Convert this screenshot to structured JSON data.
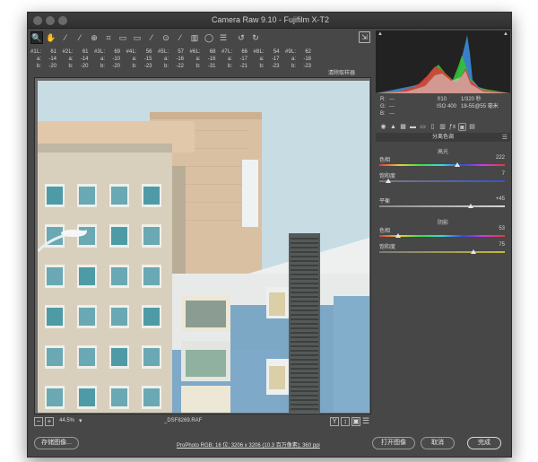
{
  "window": {
    "title": "Camera Raw 9.10  -  Fujifilm X-T2"
  },
  "toolbar": {
    "tools": [
      {
        "icon": "zoom-icon",
        "glyph": "🔍",
        "active": true
      },
      {
        "icon": "hand-icon",
        "glyph": "✋",
        "active": false
      },
      {
        "icon": "white-balance-icon",
        "glyph": "⁄",
        "active": false
      },
      {
        "icon": "color-sampler-icon",
        "glyph": "⁄",
        "active": false
      },
      {
        "icon": "targeted-adjustment-icon",
        "glyph": "⊕",
        "active": false
      },
      {
        "icon": "crop-icon",
        "glyph": "⌗",
        "active": false
      },
      {
        "icon": "straighten-icon",
        "glyph": "▭",
        "active": false
      },
      {
        "icon": "transform-icon",
        "glyph": "▭",
        "active": false
      },
      {
        "icon": "spot-removal-icon",
        "glyph": "⁄",
        "active": false
      },
      {
        "icon": "red-eye-icon",
        "glyph": "⊙",
        "active": false
      },
      {
        "icon": "adjustment-brush-icon",
        "glyph": "⁄",
        "active": false
      },
      {
        "icon": "graduated-filter-icon",
        "glyph": "▥",
        "active": false
      },
      {
        "icon": "radial-filter-icon",
        "glyph": "◯",
        "active": false
      },
      {
        "icon": "preferences-icon",
        "glyph": "☰",
        "active": false
      },
      {
        "icon": "rotate-left-icon",
        "glyph": "↺",
        "active": false
      },
      {
        "icon": "rotate-right-icon",
        "glyph": "↻",
        "active": false
      }
    ],
    "export_icon": "export-icon",
    "export_glyph": "⇲"
  },
  "samplers": [
    {
      "label": "#1",
      "rows": [
        [
          "L:",
          "61"
        ],
        [
          "a:",
          "-14"
        ],
        [
          "b:",
          "-20"
        ]
      ]
    },
    {
      "label": "#2",
      "rows": [
        [
          "L:",
          "61"
        ],
        [
          "a:",
          "-14"
        ],
        [
          "b:",
          "-20"
        ]
      ]
    },
    {
      "label": "#3",
      "rows": [
        [
          "L:",
          "69"
        ],
        [
          "a:",
          "-10"
        ],
        [
          "b:",
          "-20"
        ]
      ]
    },
    {
      "label": "#4",
      "rows": [
        [
          "L:",
          "56"
        ],
        [
          "a:",
          "-15"
        ],
        [
          "b:",
          "-23"
        ]
      ]
    },
    {
      "label": "#5",
      "rows": [
        [
          "L:",
          "57"
        ],
        [
          "a:",
          "-16"
        ],
        [
          "b:",
          "-22"
        ]
      ]
    },
    {
      "label": "#6",
      "rows": [
        [
          "L:",
          "68"
        ],
        [
          "a:",
          "-16"
        ],
        [
          "b:",
          "-31"
        ]
      ]
    },
    {
      "label": "#7",
      "rows": [
        [
          "L:",
          "66"
        ],
        [
          "a:",
          "-17"
        ],
        [
          "b:",
          "-21"
        ]
      ]
    },
    {
      "label": "#8",
      "rows": [
        [
          "L:",
          "54"
        ],
        [
          "a:",
          "-17"
        ],
        [
          "b:",
          "-23"
        ]
      ]
    },
    {
      "label": "#9",
      "rows": [
        [
          "L:",
          "62"
        ],
        [
          "a:",
          "-18"
        ],
        [
          "b:",
          "-23"
        ]
      ]
    }
  ],
  "clear_samplers_label": "清除取样器",
  "status": {
    "zoom": "44.5%",
    "filename": "_DSF8269.RAF"
  },
  "histogram": {
    "rgb_labels": [
      "R:",
      "G:",
      "B:"
    ],
    "rgb_values": [
      "---",
      "---",
      "---"
    ],
    "exif": {
      "aperture": "f/10",
      "shutter": "1/320 秒",
      "iso": "ISO 400",
      "lens": "18-55@55 毫米"
    }
  },
  "panel_tabs": [
    "◉",
    "▲",
    "▦",
    "▬",
    "▭",
    "▯",
    "▥",
    "ƒx",
    "◙",
    "▤"
  ],
  "split_toning": {
    "title": "分离色调",
    "highlights": {
      "title": "高光",
      "hue": {
        "name": "色相",
        "value": "222",
        "fraction": 0.62
      },
      "saturation": {
        "name": "饱和度",
        "value": "7",
        "fraction": 0.07
      }
    },
    "balance": {
      "name": "平衡",
      "value": "+45",
      "fraction": 0.725
    },
    "shadows": {
      "title": "阴影",
      "hue": {
        "name": "色相",
        "value": "53",
        "fraction": 0.15
      },
      "saturation": {
        "name": "饱和度",
        "value": "75",
        "fraction": 0.75
      }
    }
  },
  "bottom": {
    "save_label": "存储图像...",
    "workflow_label": "ProPhoto RGB; 16 位; 3206 x 3206 (10.3 百万像素); 360 ppi",
    "open_label": "打开图像",
    "cancel_label": "取消",
    "done_label": "完成"
  },
  "colors": {
    "window_bg": "#474747",
    "sky": "#c7dbe3",
    "facade_blue": "#7aa7c7"
  }
}
